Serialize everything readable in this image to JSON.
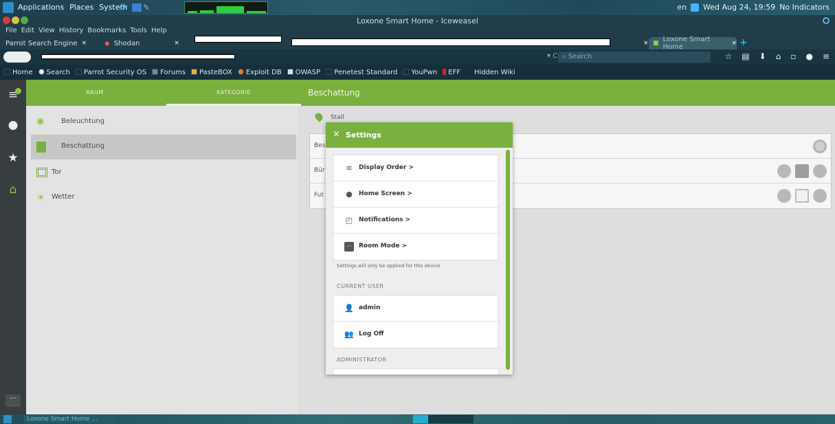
{
  "gnome_panel": {
    "menus": [
      "Applications",
      "Places",
      "System"
    ],
    "lang": "en",
    "clock": "Wed Aug 24, 19:59",
    "indicators": "No Indicators"
  },
  "window": {
    "title": "Loxone Smart Home - Iceweasel"
  },
  "menubar": [
    "File",
    "Edit",
    "View",
    "History",
    "Bookmarks",
    "Tools",
    "Help"
  ],
  "tabs": {
    "t1": "Parrot Search Engine",
    "t2": "Shodan",
    "t3": "",
    "t4": "",
    "active": "Loxone Smart Home",
    "close": "×",
    "plus": "+"
  },
  "navbar": {
    "reload": "▾ C",
    "search_placeholder": "Search"
  },
  "bookmarks": [
    "Home",
    "Search",
    "Parrot Security OS",
    "Forums",
    "PasteBOX",
    "Exploit DB",
    "OWASP",
    "Penetest Standard",
    "YouPwn",
    "EFF",
    "Hidden Wiki"
  ],
  "app": {
    "tabs": {
      "raum": "RAUM",
      "kategorie": "KATEGORIE"
    },
    "title": "Beschattung",
    "categories": [
      {
        "label": "Beleuchtung",
        "icon": "sun-icon"
      },
      {
        "label": "Beschattung",
        "icon": "blind-icon"
      },
      {
        "label": "Tor",
        "icon": "gate-icon"
      },
      {
        "label": "Wetter",
        "icon": "weather-icon"
      }
    ],
    "room_label": "Stall",
    "rows": [
      "Bes",
      "Bür",
      "Fut"
    ],
    "more": "···"
  },
  "settings": {
    "title": "Settings",
    "close": "×",
    "items": [
      {
        "label": "Display Order",
        "icon": "sort-icon"
      },
      {
        "label": "Home Screen",
        "icon": "pin-icon"
      },
      {
        "label": "Notifications",
        "icon": "notification-icon"
      },
      {
        "label": "Room Mode",
        "icon": "room-mode-icon"
      }
    ],
    "chevron": ">",
    "note": "Settings will only be applied for this device",
    "current_user_header": "CURRENT USER",
    "user": "admin",
    "logoff": "Log Off",
    "admin_header": "ADMINISTRATOR"
  },
  "taskbar": {
    "task": "Loxone Smart Home ..."
  },
  "colors": {
    "accent_green": "#7ab03e",
    "sidebar": "#383d3f",
    "background": "#d9d9d9"
  }
}
